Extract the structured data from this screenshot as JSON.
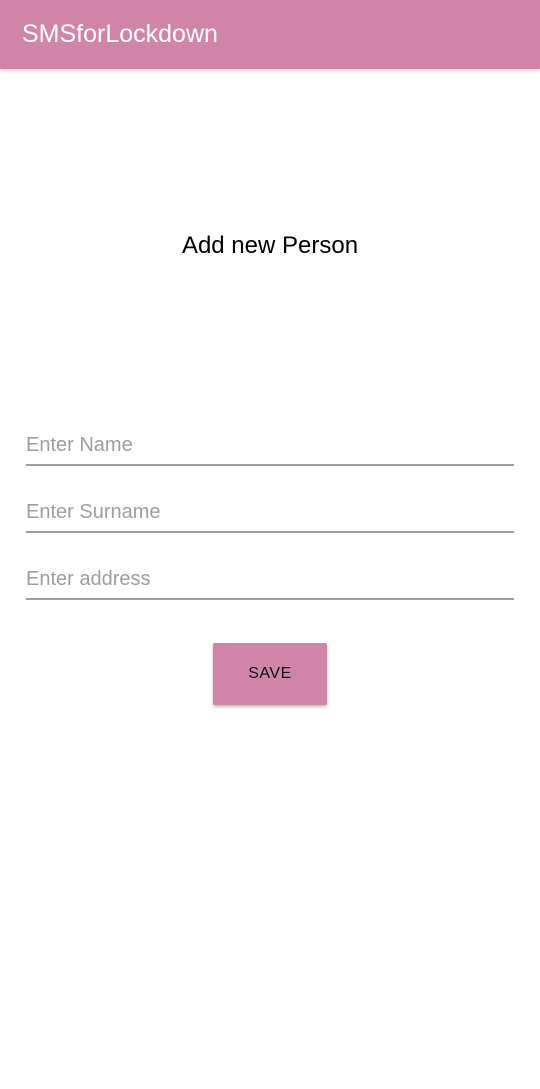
{
  "app_bar": {
    "title": "SMSforLockdown",
    "color": "#d084a8"
  },
  "form": {
    "heading": "Add new Person",
    "name_field": {
      "placeholder": "Enter Name",
      "value": ""
    },
    "surname_field": {
      "placeholder": "Enter Surname",
      "value": ""
    },
    "address_field": {
      "placeholder": "Enter address",
      "value": ""
    },
    "save_label": "SAVE"
  }
}
